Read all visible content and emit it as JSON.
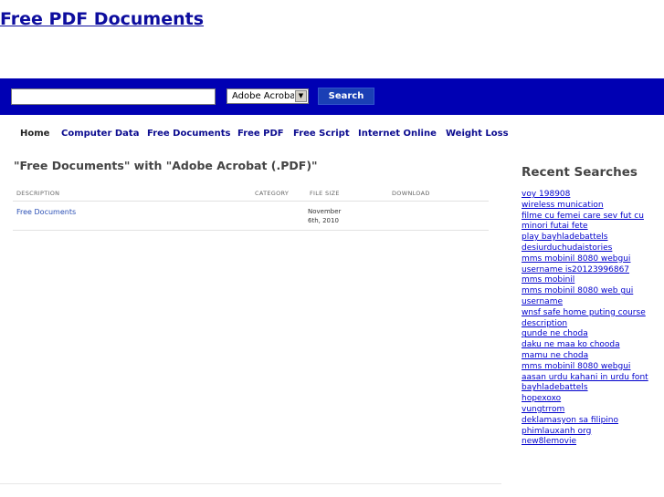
{
  "site": {
    "title": "Free PDF Documents"
  },
  "search": {
    "input_value": "",
    "filetype_selected": "Adobe Acroba",
    "button_label": "Search"
  },
  "nav": {
    "items": [
      "Home",
      "Computer Data",
      "Free Documents",
      "Free PDF",
      "Free Script",
      "Internet Online",
      "Weight Loss"
    ]
  },
  "main": {
    "heading": "\"Free Documents\" with \"Adobe Acrobat (.PDF)\"",
    "table": {
      "headers": {
        "description": "DESCRIPTION",
        "category": "CATEGORY",
        "file_size": "FILE SIZE",
        "download": "DOWNLOAD"
      },
      "rows": [
        {
          "description": "Free Documents",
          "category": "",
          "file_size_line1": "November",
          "file_size_line2": "6th, 2010",
          "download": ""
        }
      ]
    }
  },
  "sidebar": {
    "title": "Recent Searches",
    "items": [
      "voy 198908",
      "wireless munication",
      "filme cu femei care sev fut cu",
      "minori futai fete",
      "play bayhladebattels",
      "desiurduchudaistories",
      "mms mobinil 8080 webgui",
      "username is20123996867",
      "mms mobinil",
      "mms mobinil 8080 web gui",
      "username",
      "wnsf safe home puting course",
      "description",
      "gunde ne choda",
      "daku ne maa ko chooda",
      "mamu ne choda",
      "mms mobinil 8080 webgui",
      "aasan urdu kahani in urdu font",
      "bayhladebattels",
      "hopexoxo",
      "vungtrrom",
      "deklamasyon sa filipino",
      "phimlauxanh org",
      "new8lemovie"
    ]
  }
}
